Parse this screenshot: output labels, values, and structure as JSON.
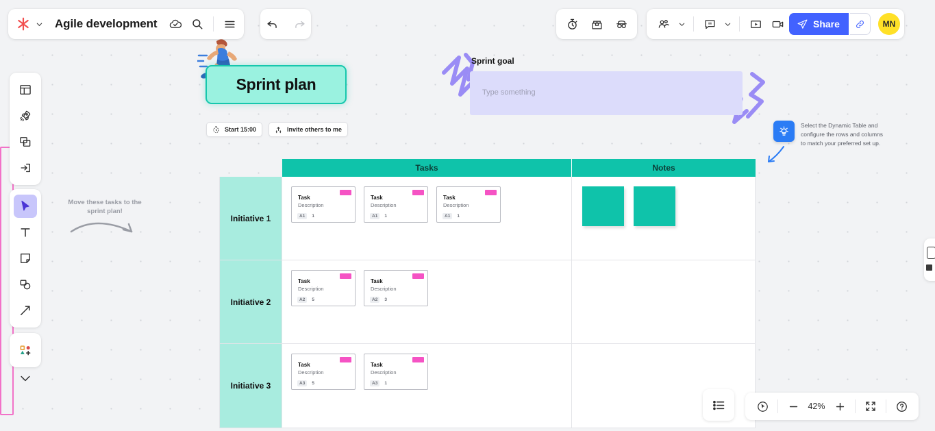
{
  "header": {
    "logo_icon": "miro-asterisk-logo",
    "logo_chevron_icon": "chevron-down-icon",
    "board_title": "Agile development",
    "cloud_check_icon": "cloud-saved-icon",
    "search_icon": "search-icon",
    "menu_icon": "hamburger-menu-icon",
    "undo_icon": "undo-arrow-icon",
    "redo_icon": "redo-arrow-icon",
    "timer_icon": "stopwatch-timer-icon",
    "voting_icon": "voting-box-icon",
    "anonymous_icon": "anonymous-glasses-icon",
    "participants_icon": "participants-group-icon",
    "participants_chevron_icon": "chevron-down-icon",
    "comment_icon": "comment-bubble-icon",
    "comment_chevron_icon": "chevron-down-icon",
    "present_icon": "present-play-icon",
    "video_icon": "video-camera-icon",
    "share_label": "Share",
    "share_send_icon": "paper-plane-icon",
    "copy_link_icon": "link-chain-icon",
    "avatar_initials": "MN"
  },
  "toolbar": {
    "groups": [
      {
        "items": [
          {
            "icon": "templates-icon",
            "name": "templates"
          },
          {
            "icon": "rocket-apps-icon",
            "name": "apps"
          },
          {
            "icon": "frames-icon",
            "name": "frames"
          },
          {
            "icon": "import-icon",
            "name": "import"
          }
        ]
      },
      {
        "items": [
          {
            "icon": "cursor-select-icon",
            "name": "select",
            "active": true
          },
          {
            "icon": "text-icon",
            "name": "text"
          },
          {
            "icon": "sticky-note-icon",
            "name": "sticky-note"
          },
          {
            "icon": "shapes-icon",
            "name": "shapes"
          },
          {
            "icon": "arrow-line-icon",
            "name": "connection-line"
          }
        ]
      },
      {
        "items": [
          {
            "icon": "more-shapes-icon",
            "name": "more-apps"
          }
        ]
      },
      {
        "items": [
          {
            "icon": "chevron-down-icon",
            "name": "collapse-toolbar"
          }
        ]
      }
    ]
  },
  "board": {
    "sprint_title": "Sprint plan",
    "runner_illustration": "running-person-illustration",
    "timer_button": {
      "label": "Start 15:00",
      "icon": "timer-icon"
    },
    "invite_button": {
      "label": "Invite others to me",
      "icon": "bring-to-me-icon"
    },
    "sprint_goal": {
      "label": "Sprint goal",
      "placeholder": "Type something",
      "value": ""
    },
    "decor_left_icon": "purple-zigzag-scribble",
    "decor_right_icon": "purple-zigzag-scribble",
    "tip": {
      "icon": "lightbulb-idea-icon",
      "text": "Select the Dynamic Table and configure the rows and columns to match your preferred set up.",
      "arrow_icon": "curved-arrow-down-left-icon"
    },
    "hint": {
      "text": "Move these tasks to the sprint plan!",
      "arrow_icon": "curved-arrow-right-icon"
    },
    "edge_panel_icon": "panel-peek-icon"
  },
  "table": {
    "columns": [
      "Tasks",
      "Notes"
    ],
    "rows": [
      {
        "label": "Initiative 1",
        "tasks": [
          {
            "title": "Task",
            "description": "Description",
            "tag": "A1",
            "points": "1",
            "badge": "new-badge"
          },
          {
            "title": "Task",
            "description": "Description",
            "tag": "A1",
            "points": "1",
            "badge": "new-badge"
          },
          {
            "title": "Task",
            "description": "Description",
            "tag": "A1",
            "points": "1",
            "badge": "new-badge"
          }
        ],
        "notes": [
          "",
          ""
        ]
      },
      {
        "label": "Initiative 2",
        "tasks": [
          {
            "title": "Task",
            "description": "Description",
            "tag": "A2",
            "points": "5",
            "badge": "new-badge"
          },
          {
            "title": "Task",
            "description": "Description",
            "tag": "A2",
            "points": "3",
            "badge": "new-badge"
          }
        ],
        "notes": []
      },
      {
        "label": "Initiative 3",
        "tasks": [
          {
            "title": "Task",
            "description": "Description",
            "tag": "A3",
            "points": "5",
            "badge": "new-badge"
          },
          {
            "title": "Task",
            "description": "Description",
            "tag": "A3",
            "points": "1",
            "badge": "new-badge"
          }
        ],
        "notes": []
      }
    ]
  },
  "footer": {
    "list_icon": "board-outline-list-icon",
    "cursor_icon": "attention-cursor-icon",
    "zoom_out_icon": "minus-icon",
    "zoom_level": "42%",
    "zoom_in_icon": "plus-icon",
    "fit_screen_icon": "fit-to-screen-icon",
    "help_icon": "help-question-icon"
  },
  "colors": {
    "brand_blue": "#4262ff",
    "teal": "#0fc3aa",
    "teal_light": "#a8ecdf",
    "badge_pink": "#f553c4",
    "goal_lavender": "#dcdcfb",
    "avatar_yellow": "#ffe027",
    "presence_pink": "#f272c8",
    "tip_blue": "#2b7cf5"
  }
}
